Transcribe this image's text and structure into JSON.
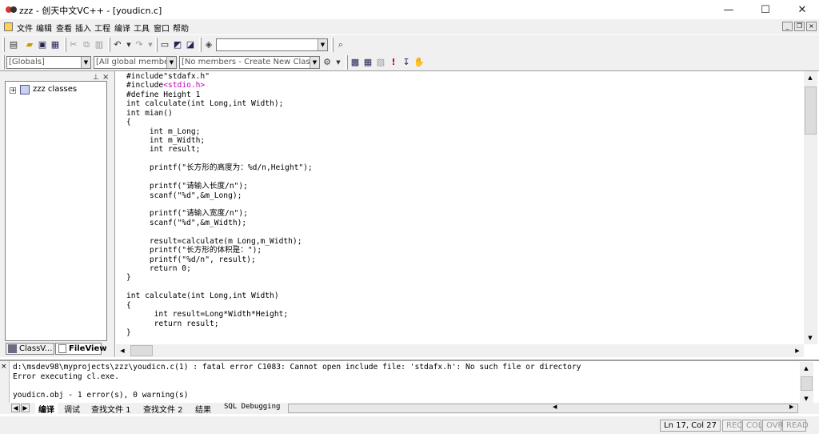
{
  "window": {
    "title": "zzz - 创天中文VC++ - [youdicn.c]",
    "minimize": "—",
    "maximize": "☐",
    "close": "✕"
  },
  "menu": [
    "文件",
    "编辑",
    "查看",
    "插入",
    "工程",
    "编译",
    "工具",
    "窗口",
    "帮助"
  ],
  "mdi_controls": {
    "minimize": "_",
    "restore": "❐",
    "close": "×"
  },
  "toolbar1": {
    "find_combo_value": ""
  },
  "toolbar2": {
    "combo_globals": "[Globals]",
    "combo_members": "[All global members",
    "combo_new_class": "[No members - Create New Class...]"
  },
  "workspace": {
    "tree_root": "zzz classes",
    "tabs": [
      "ClassV...",
      "FileView"
    ]
  },
  "editor": {
    "lines": [
      [
        "#include\"stdafx.h\""
      ],
      [
        "#include",
        "<stdio.h>"
      ],
      [
        "#define Height 1"
      ],
      [
        "int calculate(int Long,int Width);"
      ],
      [
        "int mian()"
      ],
      [
        "{"
      ],
      [
        "     int m_Long;"
      ],
      [
        "     int m_Width;"
      ],
      [
        "     int result;"
      ],
      [
        ""
      ],
      [
        "     printf(\"长方形的高度为：%d/n,Height\");"
      ],
      [
        ""
      ],
      [
        "     printf(\"请输入长度/n\");"
      ],
      [
        "     scanf(\"%d\",&m_Long);"
      ],
      [
        ""
      ],
      [
        "     printf(\"请输入宽度/n\");"
      ],
      [
        "     scanf(\"%d\",&m_Width);"
      ],
      [
        ""
      ],
      [
        "     result=calculate(m_Long,m_Width);"
      ],
      [
        "     printf(\"长方形的体积是：\");"
      ],
      [
        "     printf(\"%d/n\", result);"
      ],
      [
        "     return 0;"
      ],
      [
        "}"
      ],
      [
        ""
      ],
      [
        "int calculate(int Long,int Width)"
      ],
      [
        "{"
      ],
      [
        "      int result=Long*Width*Height;"
      ],
      [
        "      return result;"
      ],
      [
        "}"
      ]
    ]
  },
  "output": {
    "lines": [
      "d:\\msdev98\\myprojects\\zzz\\youdicn.c(1) : fatal error C1083: Cannot open include file: 'stdafx.h': No such file or directory",
      "Error executing cl.exe.",
      "",
      "youdicn.obj - 1 error(s), 0 warning(s)"
    ],
    "tabs": [
      "编译",
      "调试",
      "查找文件 1",
      "查找文件 2",
      "结果",
      "SQL Debugging"
    ]
  },
  "status": {
    "position": "Ln 17, Col 27",
    "rec": "REC",
    "col": "COL",
    "ovr": "OVR",
    "read": "READ"
  }
}
